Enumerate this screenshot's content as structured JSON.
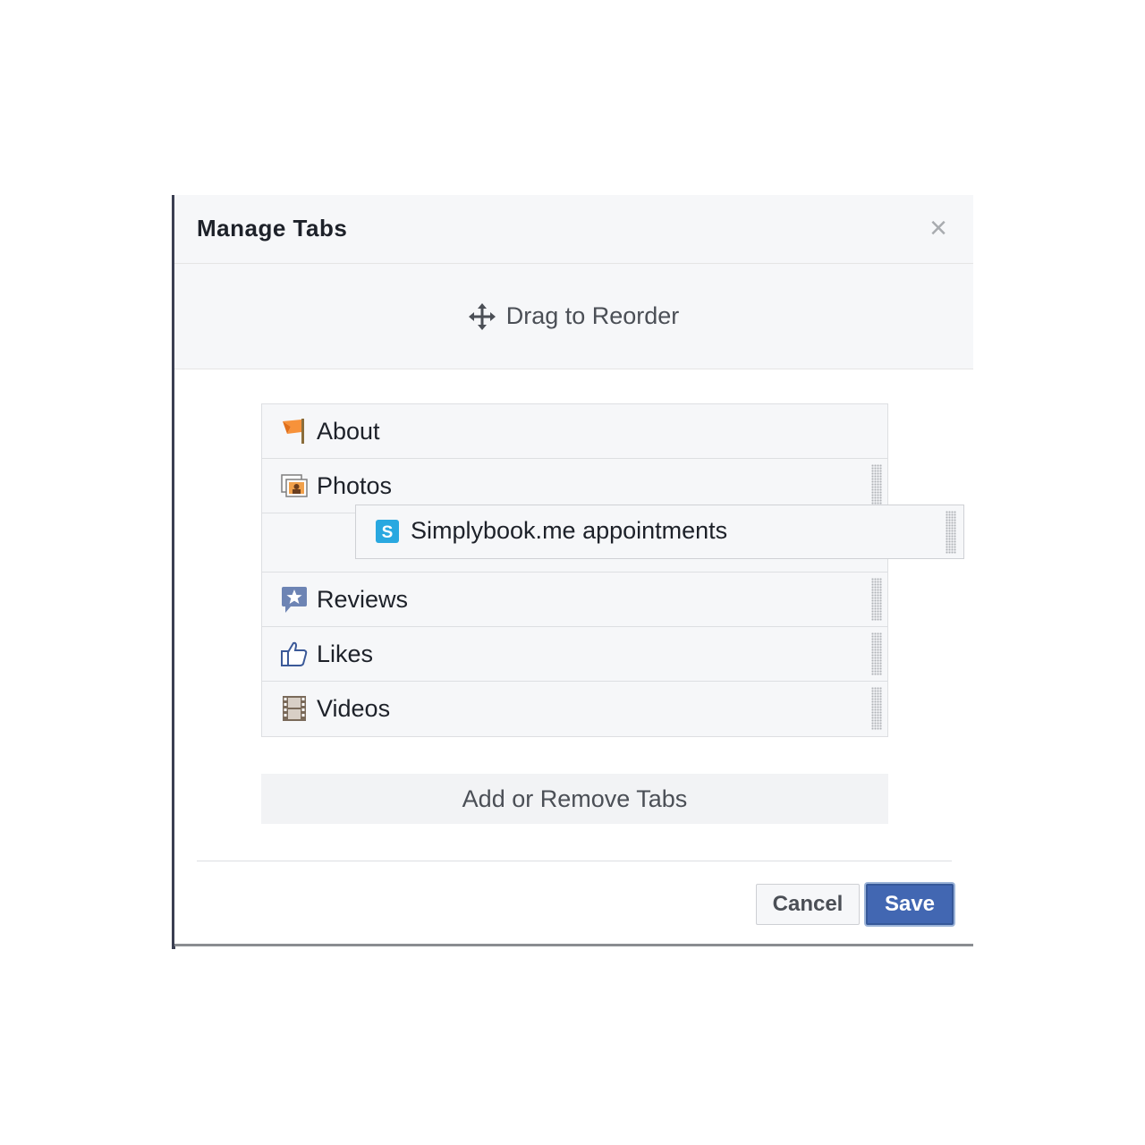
{
  "dialog": {
    "title": "Manage Tabs",
    "close_label": "×",
    "drag_hint": "Drag to Reorder"
  },
  "tabs": [
    {
      "label": "About",
      "icon": "about-flag-icon"
    },
    {
      "label": "Photos",
      "icon": "photos-icon"
    },
    {
      "label": "Reviews",
      "icon": "reviews-star-icon"
    },
    {
      "label": "Likes",
      "icon": "like-thumb-icon"
    },
    {
      "label": "Videos",
      "icon": "video-film-icon"
    }
  ],
  "dragging_tab": {
    "label": "Simplybook.me appointments",
    "icon": "simplybook-icon"
  },
  "add_remove_label": "Add or Remove Tabs",
  "footer": {
    "cancel_label": "Cancel",
    "save_label": "Save"
  },
  "colors": {
    "primary": "#4267b2",
    "header_bg": "#f6f7f9",
    "text": "#1d2129"
  }
}
